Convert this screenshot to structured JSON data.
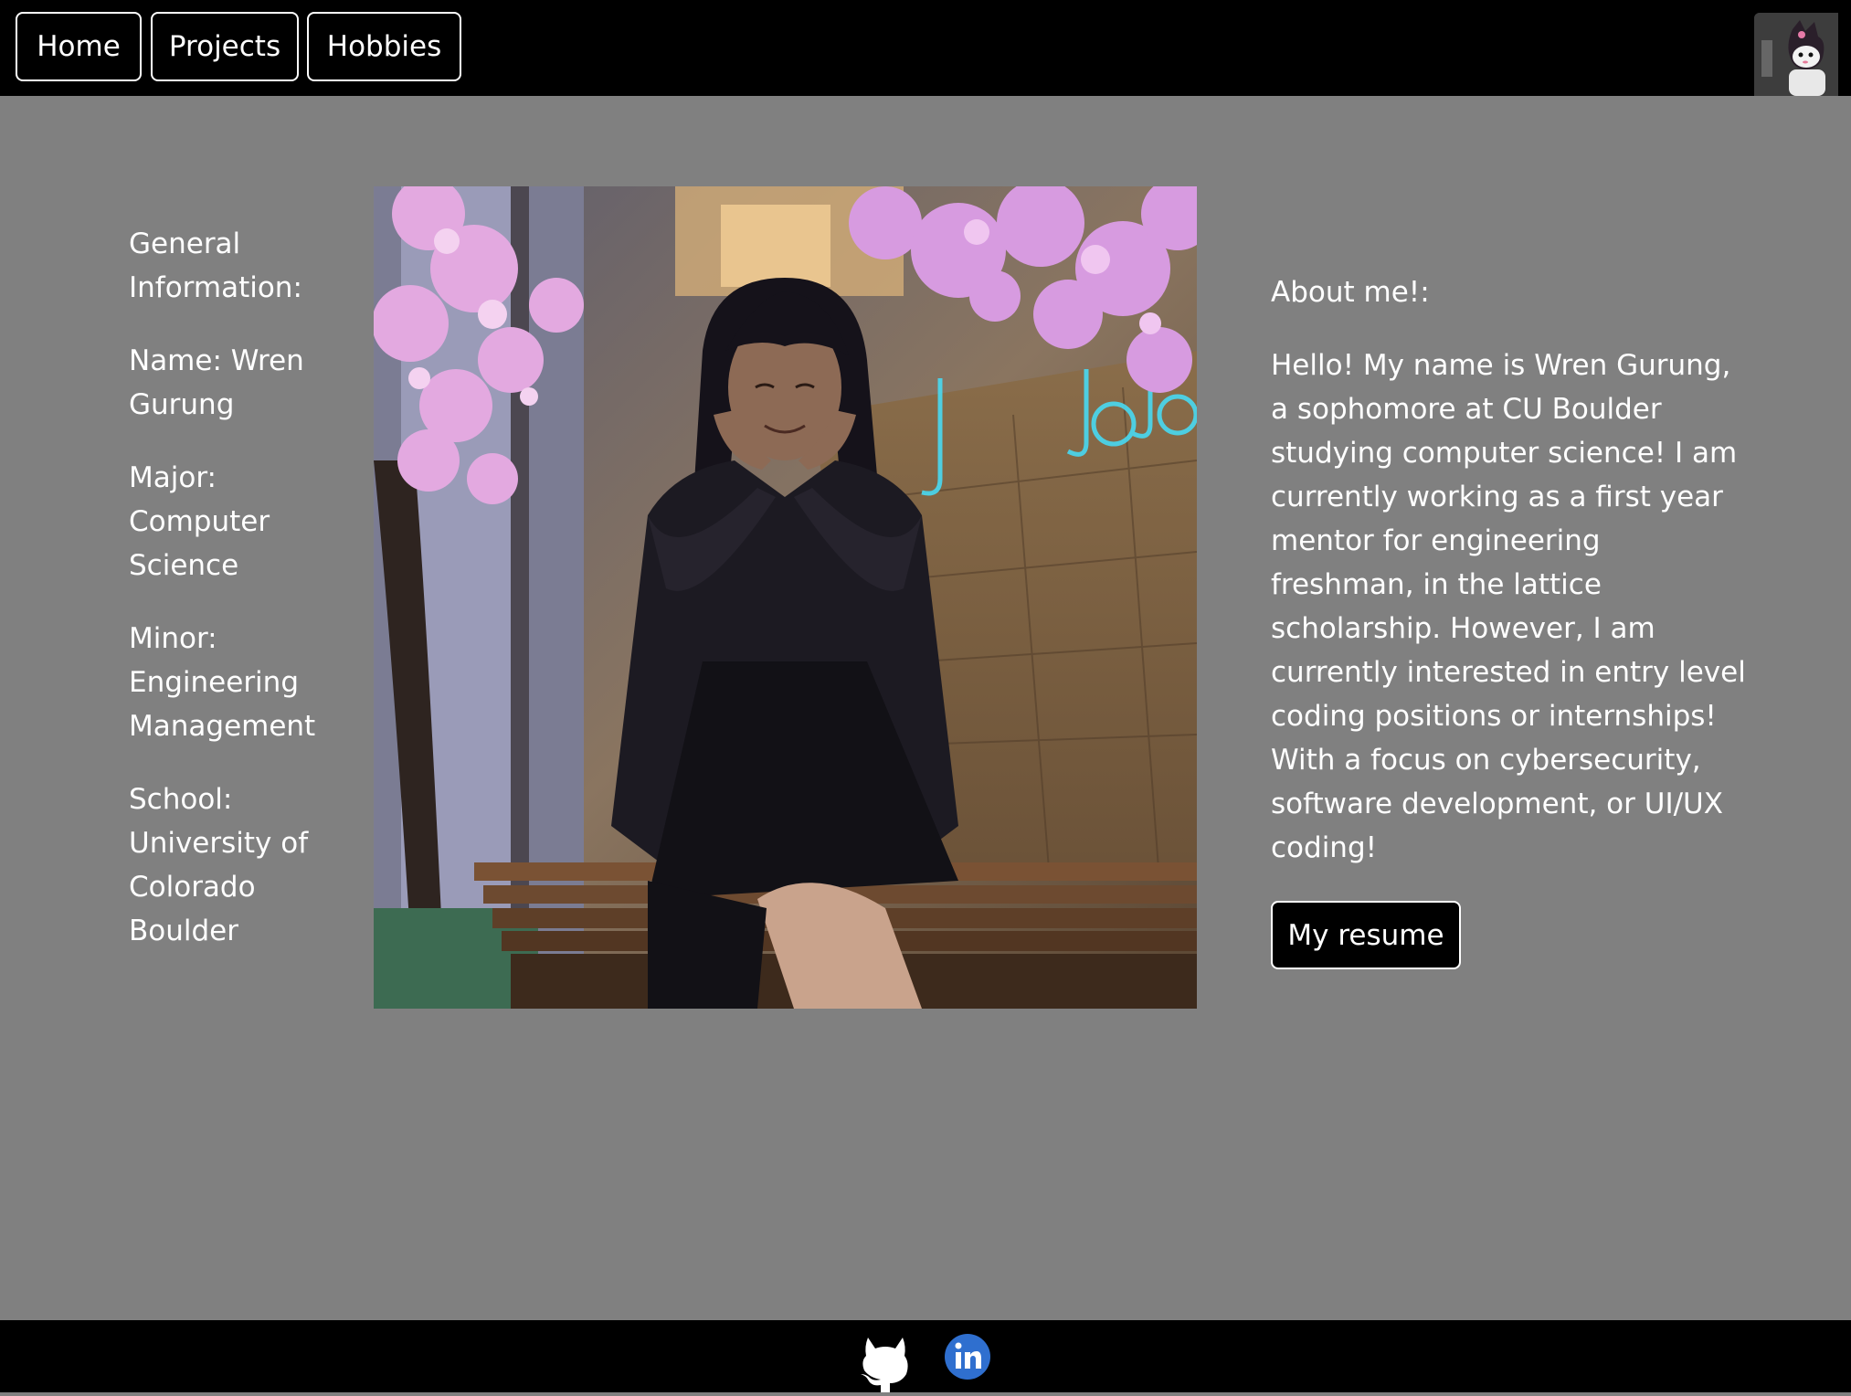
{
  "nav": {
    "items": [
      {
        "label": "Home"
      },
      {
        "label": "Projects"
      },
      {
        "label": "Hobbies"
      }
    ],
    "avatar_icon": "character-avatar"
  },
  "info": {
    "heading": "General Information:",
    "name": "Name: Wren Gurung",
    "major": "Major: Computer Science",
    "minor": "Minor: Engineering Management",
    "school": "School: University of Colorado Boulder"
  },
  "photo": {
    "alt": "Portrait of Wren Gurung"
  },
  "about": {
    "heading": "About me!:",
    "body": "Hello! My name is Wren Gurung, a sophomore at CU Boulder studying computer science! I am currently working as a first year mentor for engineering freshman, in the lattice scholarship. However, I am currently interested in entry level coding positions or internships! With a focus on cybersecurity, software development, or UI/UX coding!",
    "resume_label": "My resume"
  },
  "footer": {
    "icons": [
      "github-icon",
      "linkedin-icon"
    ],
    "linkedin_color": "#2f6fcf"
  },
  "colors": {
    "nav_bg": "#000000",
    "main_bg": "#808080",
    "text": "#ffffff"
  }
}
